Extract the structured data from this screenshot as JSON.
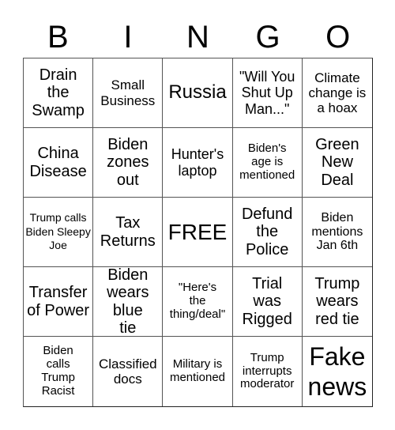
{
  "header": [
    "B",
    "I",
    "N",
    "G",
    "O"
  ],
  "cells": [
    "Drain the Swamp",
    "Small Business",
    "Russia",
    "\"Will You Shut Up Man...\"",
    "Climate change is a hoax",
    "China Disease",
    "Biden zones out",
    "Hunter's laptop",
    "Biden's age is mentioned",
    "Green New Deal",
    "Trump calls Biden Sleepy Joe",
    "Tax Returns",
    "FREE",
    "Defund the Police",
    "Biden mentions Jan 6th",
    "Transfer of Power",
    "Biden wears blue tie",
    "\"Here's the thing/deal\"",
    "Trial was Rigged",
    "Trump wears red tie",
    "Biden calls Trump Racist",
    "Classified docs",
    "Military is mentioned",
    "Trump interrupts moderator",
    "Fake news"
  ]
}
